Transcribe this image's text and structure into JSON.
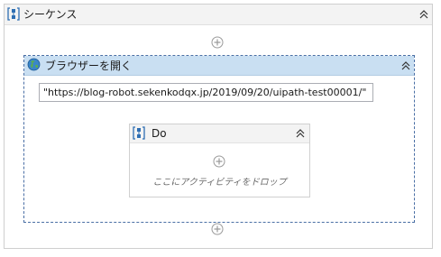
{
  "sequence": {
    "title": "シーケンス",
    "icon": "sequence-icon",
    "collapse_icon": "double-chevron-up-icon",
    "add_icon": "plus-circle-icon"
  },
  "open_browser": {
    "title": "ブラウザーを開く",
    "icon": "globe-icon",
    "collapse_icon": "double-chevron-up-icon",
    "url_value": "\"https://blog-robot.sekenkodqx.jp/2019/09/20/uipath-test00001/\""
  },
  "do_block": {
    "title": "Do",
    "icon": "sequence-icon",
    "collapse_icon": "double-chevron-up-icon",
    "add_icon": "plus-circle-icon",
    "drop_hint": "ここにアクティビティをドロップ"
  },
  "colors": {
    "browser_header": "#c9dff2",
    "browser_border": "#4a6fa5",
    "sequence_icon": "#2f6fb3"
  }
}
